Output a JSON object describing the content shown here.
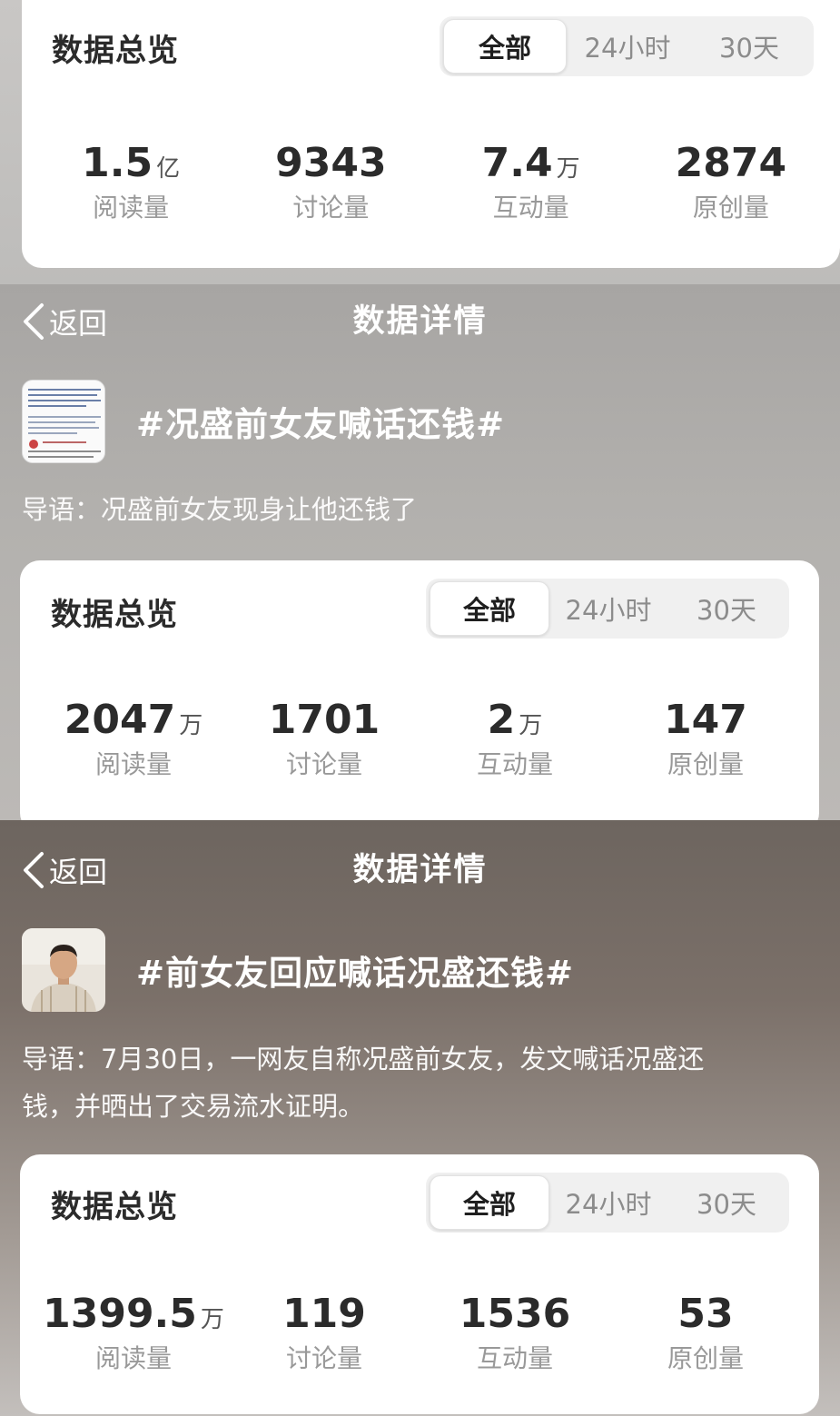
{
  "card1": {
    "title": "数据总览",
    "tabs": [
      "全部",
      "24小时",
      "30天"
    ],
    "stats": [
      {
        "num": "1.5",
        "unit": "亿",
        "label": "阅读量"
      },
      {
        "num": "9343",
        "unit": "",
        "label": "讨论量"
      },
      {
        "num": "7.4",
        "unit": "万",
        "label": "互动量"
      },
      {
        "num": "2874",
        "unit": "",
        "label": "原创量"
      }
    ]
  },
  "detail1": {
    "back": "返回",
    "title": "数据详情",
    "topic": "#况盛前女友喊话还钱#",
    "intro": "导语：况盛前女友现身让他还钱了",
    "card": {
      "title": "数据总览",
      "tabs": [
        "全部",
        "24小时",
        "30天"
      ],
      "stats": [
        {
          "num": "2047",
          "unit": "万",
          "label": "阅读量"
        },
        {
          "num": "1701",
          "unit": "",
          "label": "讨论量"
        },
        {
          "num": "2",
          "unit": "万",
          "label": "互动量"
        },
        {
          "num": "147",
          "unit": "",
          "label": "原创量"
        }
      ]
    }
  },
  "detail2": {
    "back": "返回",
    "title": "数据详情",
    "topic": "#前女友回应喊话况盛还钱#",
    "intro_line1": "导语：7月30日，一网友自称况盛前女友，发文喊话况盛还",
    "intro_line2": "钱，并晒出了交易流水证明。",
    "card": {
      "title": "数据总览",
      "tabs": [
        "全部",
        "24小时",
        "30天"
      ],
      "stats": [
        {
          "num": "1399.5",
          "unit": "万",
          "label": "阅读量"
        },
        {
          "num": "119",
          "unit": "",
          "label": "讨论量"
        },
        {
          "num": "1536",
          "unit": "",
          "label": "互动量"
        },
        {
          "num": "53",
          "unit": "",
          "label": "原创量"
        }
      ]
    }
  },
  "colors": {
    "card_bg": "#ffffff",
    "text_dark": "#2b2b2b",
    "label_gray": "#999999"
  }
}
